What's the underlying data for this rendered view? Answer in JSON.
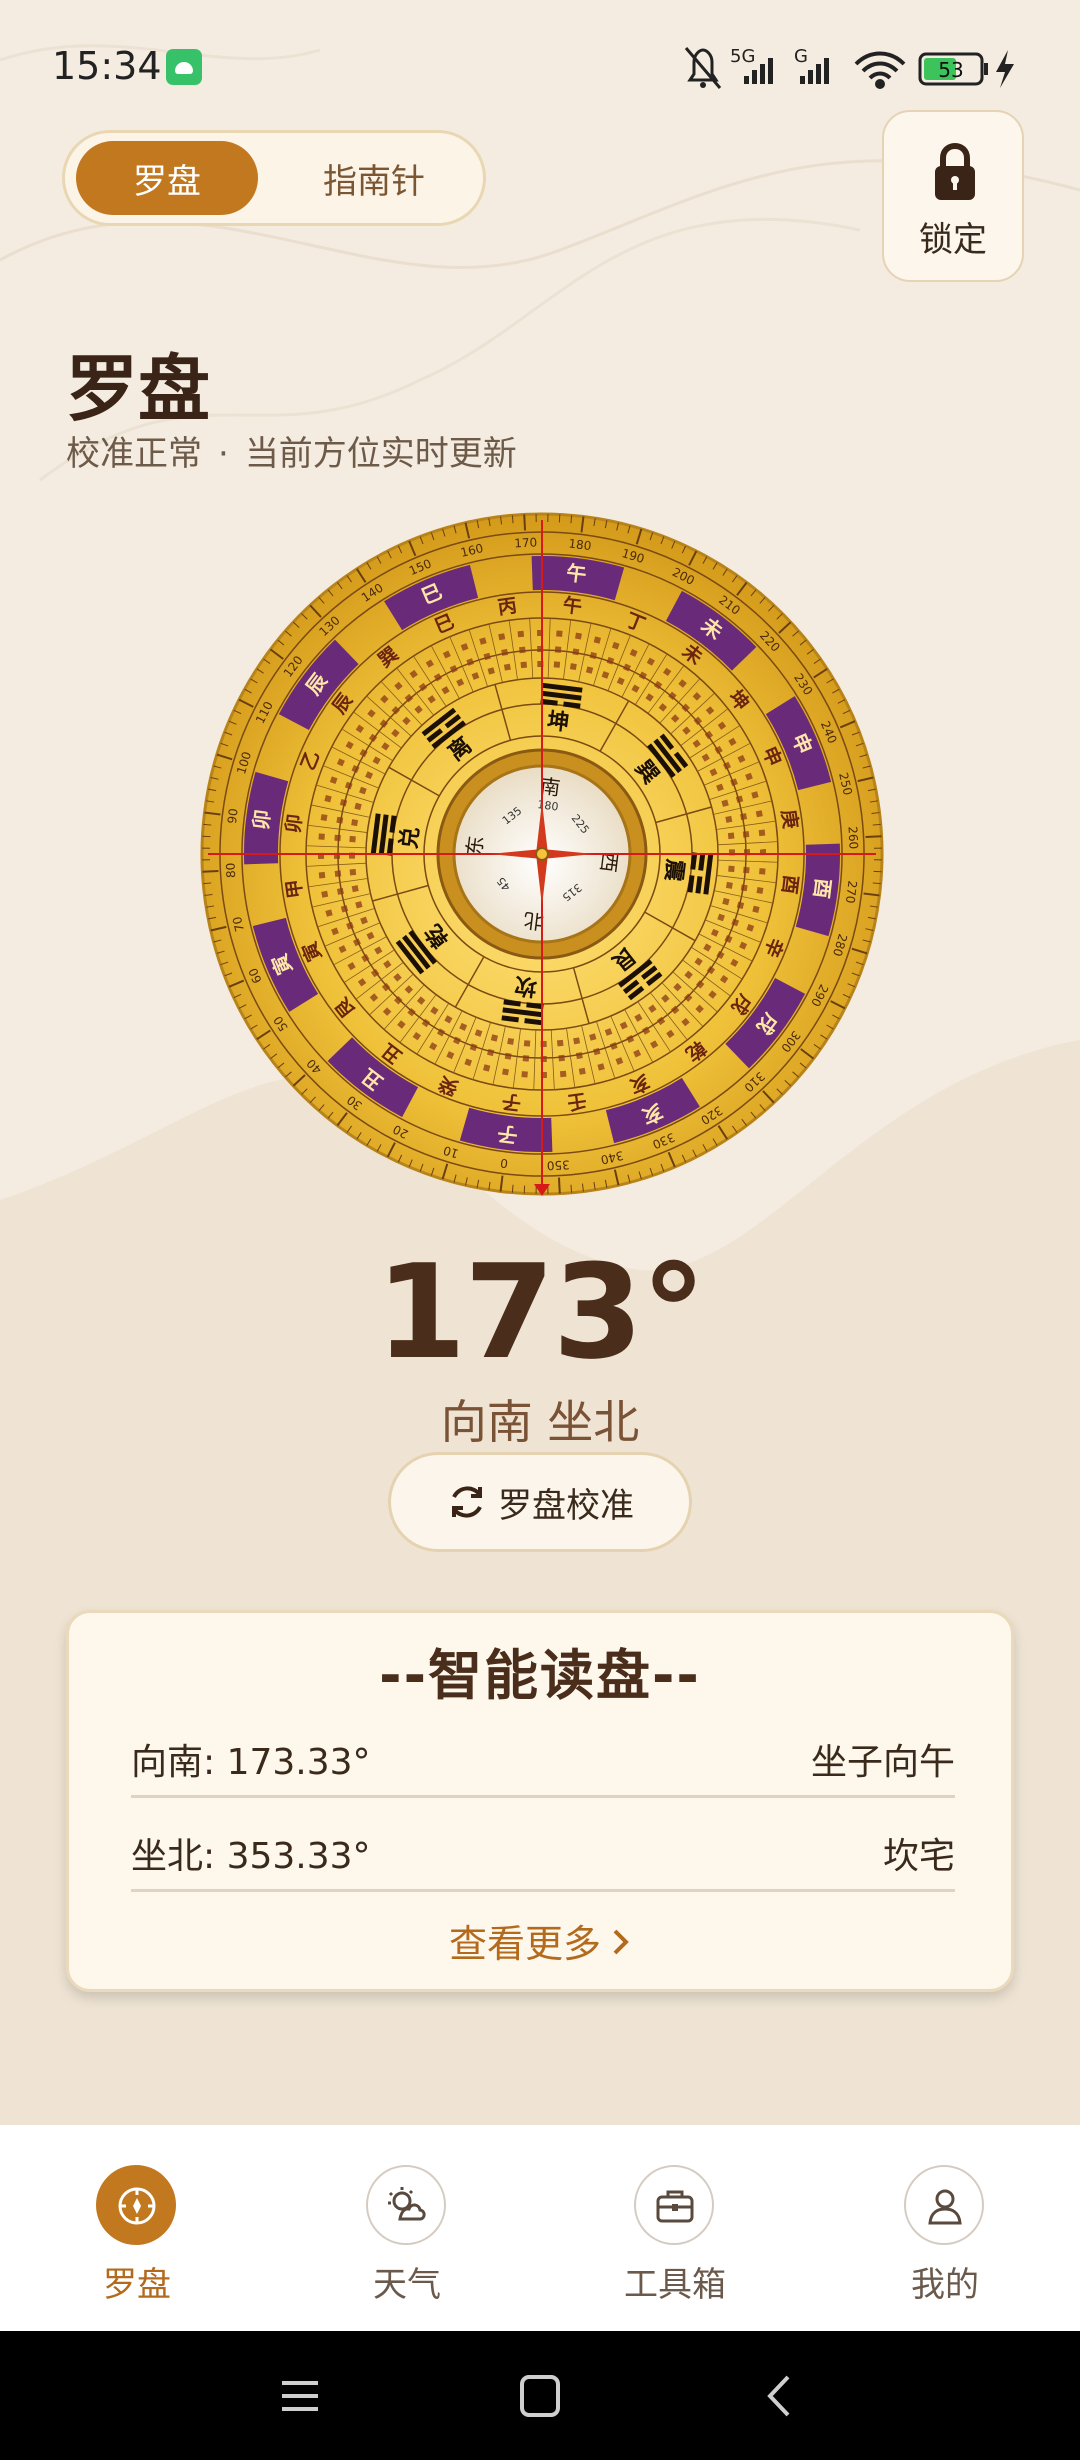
{
  "status_bar": {
    "time": "15:34",
    "signal_label_1": "5G",
    "signal_label_2": "G",
    "battery": "53",
    "icons": [
      "app-notification-icon",
      "mute-bell-icon",
      "signal-icon",
      "wifi-icon",
      "battery-icon",
      "charging-icon"
    ]
  },
  "tabs": [
    {
      "label": "罗盘",
      "active": true
    },
    {
      "label": "指南针",
      "active": false
    }
  ],
  "lock_button": {
    "label": "锁定",
    "icon": "lock-icon"
  },
  "page": {
    "title": "罗盘",
    "subtitle_status": "校准正常",
    "subtitle_separator": "·",
    "subtitle_info": "当前方位实时更新"
  },
  "compass": {
    "heading_degrees": 173,
    "cardinal_labels": {
      "south": "南",
      "north": "北",
      "east": "东",
      "west": "西"
    },
    "inner_degree_labels": [
      "180",
      "225",
      "315",
      "45",
      "135"
    ],
    "trigrams": [
      "坤",
      "巽",
      "震",
      "艮",
      "坎",
      "乾",
      "兑",
      "离"
    ],
    "stems_branches": [
      "午",
      "丁",
      "未",
      "坤",
      "申",
      "庚",
      "酉",
      "辛",
      "戌",
      "乾",
      "亥",
      "壬",
      "子",
      "癸",
      "丑",
      "艮",
      "寅",
      "甲",
      "卯",
      "乙",
      "辰",
      "巽",
      "巳",
      "丙"
    ],
    "highlight_marks": [
      "巳",
      "午",
      "未",
      "申",
      "酉",
      "戌",
      "亥",
      "子",
      "丑",
      "寅",
      "卯",
      "辰"
    ],
    "outer_tick_labels": [
      "0",
      "10",
      "20",
      "30",
      "40",
      "50",
      "60",
      "70",
      "80",
      "90",
      "100",
      "110",
      "120",
      "130",
      "140",
      "150",
      "160",
      "170",
      "180",
      "190",
      "200",
      "210",
      "220",
      "230",
      "240",
      "250",
      "260",
      "270",
      "280",
      "290",
      "300",
      "310",
      "320",
      "330",
      "340",
      "350"
    ]
  },
  "reading": {
    "degree": "173°",
    "direction": "向南 坐北"
  },
  "calibrate_button": {
    "label": "罗盘校准",
    "icon": "refresh-icon"
  },
  "smart_reading": {
    "title": "--智能读盘--",
    "rows": [
      {
        "left": "向南: 173.33°",
        "right": "坐子向午"
      },
      {
        "left": "坐北: 353.33°",
        "right": "坎宅"
      }
    ],
    "more_label": "查看更多",
    "more_icon": "chevron-right-icon"
  },
  "bottom_nav": [
    {
      "label": "罗盘",
      "icon": "compass-icon",
      "active": true
    },
    {
      "label": "天气",
      "icon": "weather-icon",
      "active": false
    },
    {
      "label": "工具箱",
      "icon": "toolbox-icon",
      "active": false
    },
    {
      "label": "我的",
      "icon": "user-icon",
      "active": false
    }
  ],
  "system_nav": [
    "menu-icon",
    "home-icon",
    "back-icon"
  ],
  "colors": {
    "accent": "#c1781f",
    "background": "#f4ece0",
    "compass_gold": "#e9b52c",
    "compass_purple": "#6a2a7a",
    "needle_red": "#d61a1a"
  }
}
